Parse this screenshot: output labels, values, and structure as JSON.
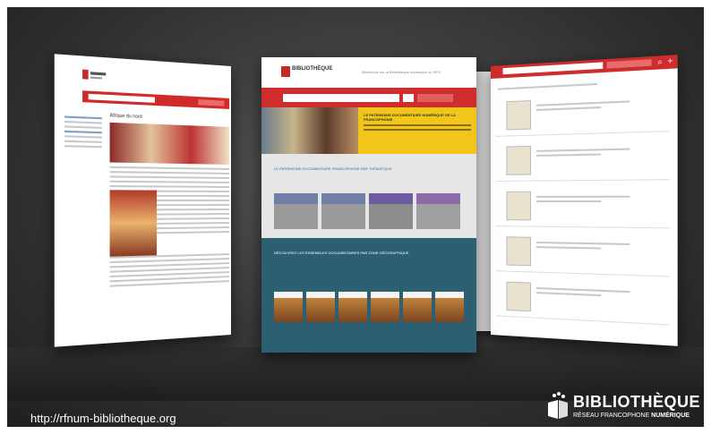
{
  "footer": {
    "url": "http://rfnum-bibliotheque.org"
  },
  "brand": {
    "title": "BIBLIOTHÈQUE",
    "subtitle_main": "RÉSEAU FRANCOPHONE",
    "subtitle_accent": "NUMÉRIQUE"
  },
  "left_page": {
    "article_title": "Afrique du nord"
  },
  "center_page": {
    "welcome": "Bienvenue sur la Bibliothèque numérique du RFN",
    "hero_title": "LE PATRIMOINE DOCUMENTAIRE NUMÉRIQUE DE LA FRANCOPHONIE",
    "section_theme": "LE PATRIMOINE DOCUMENTAIRE FRANCOPHONE PAR THÉMATIQUE",
    "section_zone": "DÉCOUVREZ LES ENSEMBLES DOCUMENTAIRES PAR ZONE GÉOGRAPHIQUE"
  },
  "colors": {
    "brand_red": "#cf2d2d",
    "hero_yellow": "#f2c51a",
    "teal": "#2d5f72"
  }
}
